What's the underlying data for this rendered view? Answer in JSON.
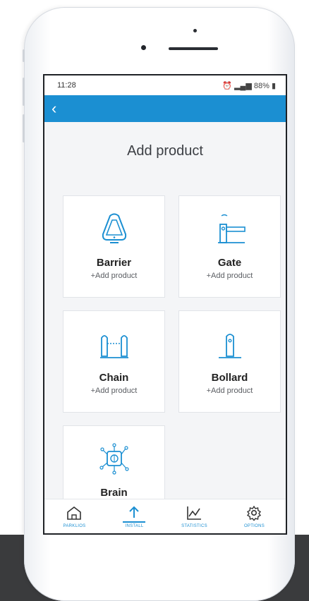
{
  "colors": {
    "accent": "#1b8fd2",
    "icon_stroke": "#1b8fd2",
    "tab_icon": "#333333"
  },
  "status_bar": {
    "time": "11:28",
    "battery": "88%"
  },
  "page": {
    "title": "Add product"
  },
  "products": [
    {
      "name": "Barrier",
      "add_label": "+Add product",
      "icon": "barrier-icon"
    },
    {
      "name": "Gate",
      "add_label": "+Add product",
      "icon": "gate-icon"
    },
    {
      "name": "Chain",
      "add_label": "+Add product",
      "icon": "chain-icon"
    },
    {
      "name": "Bollard",
      "add_label": "+Add product",
      "icon": "bollard-icon"
    },
    {
      "name": "Brain",
      "icon": "brain-chip-icon"
    }
  ],
  "tabs": [
    {
      "label": "PARKLIOS",
      "icon": "home-icon",
      "active": false
    },
    {
      "label": "INSTALL",
      "icon": "upload-icon",
      "active": true
    },
    {
      "label": "STATISTICS",
      "icon": "chart-icon",
      "active": false
    },
    {
      "label": "OPTIONS",
      "icon": "gear-icon",
      "active": false
    }
  ]
}
